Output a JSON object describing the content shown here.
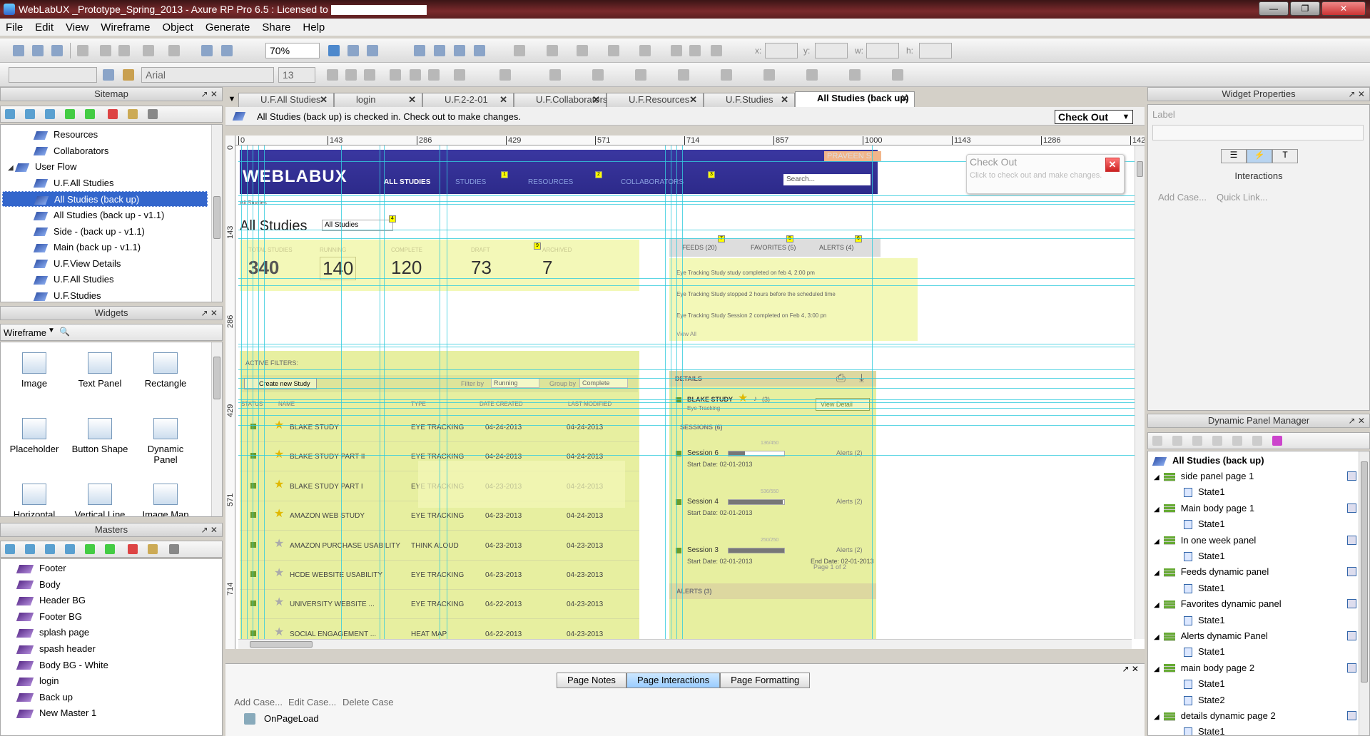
{
  "window": {
    "title": "WebLabUX _Prototype_Spring_2013 - Axure RP Pro 6.5 : Licensed to",
    "min": "—",
    "max": "❐",
    "close": "✕"
  },
  "menu": [
    "File",
    "Edit",
    "View",
    "Wireframe",
    "Object",
    "Generate",
    "Share",
    "Help"
  ],
  "toolbar": {
    "zoom": "70%",
    "x_label": "x:",
    "y_label": "y:",
    "w_label": "w:",
    "h_label": "h:",
    "font": "Arial",
    "font_size": "13",
    "style_value": ""
  },
  "sitemap": {
    "title": "Sitemap",
    "items": [
      {
        "label": "Resources",
        "indent": 2
      },
      {
        "label": "Collaborators",
        "indent": 2
      },
      {
        "label": "User Flow",
        "indent": 1,
        "folder": true
      },
      {
        "label": "U.F.All Studies",
        "indent": 2
      },
      {
        "label": "All Studies (back up)",
        "indent": 2,
        "selected": true
      },
      {
        "label": "All Studies (back up - v1.1)",
        "indent": 2
      },
      {
        "label": "Side - (back up - v1.1)",
        "indent": 2
      },
      {
        "label": "Main (back up - v1.1)",
        "indent": 2
      },
      {
        "label": "U.F.View Details",
        "indent": 2
      },
      {
        "label": "U.F.All Studies",
        "indent": 2
      },
      {
        "label": "U.F.Studies",
        "indent": 2
      }
    ]
  },
  "widgets": {
    "title": "Widgets",
    "library": "Wireframe",
    "items": [
      "Image",
      "Text Panel",
      "Rectangle",
      "Placeholder",
      "Button Shape",
      "Dynamic Panel",
      "Horizontal Line",
      "Vertical Line",
      "Image Map"
    ]
  },
  "masters": {
    "title": "Masters",
    "items": [
      "Footer",
      "Body",
      "Header BG",
      "Footer BG",
      "splash page",
      "spash header",
      "Body BG - White",
      "login",
      "Back up",
      "New Master 1"
    ]
  },
  "tabs": [
    {
      "label": "U.F.All Studies"
    },
    {
      "label": "login"
    },
    {
      "label": "U.F.2-2-01"
    },
    {
      "label": "U.F.Collaborators"
    },
    {
      "label": "U.F.Resources"
    },
    {
      "label": "U.F.Studies"
    },
    {
      "label": "All Studies (back up)",
      "active": true
    }
  ],
  "checkin": {
    "message": "All Studies (back up) is checked in. Check out to make changes.",
    "button": "Check Out"
  },
  "ruler": {
    "h": [
      "0",
      "143",
      "286",
      "429",
      "571",
      "714",
      "857",
      "1000",
      "1143",
      "1286",
      "142"
    ],
    "v": [
      "0",
      "143",
      "286",
      "429",
      "571",
      "714"
    ]
  },
  "design": {
    "logo": "WEBLABUX",
    "user": "PRAVEEN S.",
    "nav": [
      {
        "label": "ALL STUDIES",
        "badge": ""
      },
      {
        "label": "STUDIES",
        "badge": "1"
      },
      {
        "label": "RESOURCES",
        "badge": "2"
      },
      {
        "label": "COLLABORATORS",
        "badge": "3"
      }
    ],
    "search_placeholder": "Search...",
    "crumb": "All Studies",
    "page_title": "All Studies",
    "filter_select": "All Studies",
    "filter_select_badge": "4",
    "stats": [
      {
        "label": "TOTAL STUDIES",
        "value": "340"
      },
      {
        "label": "RUNNING",
        "value": "140"
      },
      {
        "label": "COMPLETE",
        "value": "120"
      },
      {
        "label": "DRAFT",
        "value": "73"
      },
      {
        "label": "ARCHIVED",
        "value": "7"
      }
    ],
    "stats_badge": "9",
    "feed_tabs": [
      {
        "label": "FEEDS (20)",
        "badge": "7"
      },
      {
        "label": "FAVORITES (5)",
        "badge": "5"
      },
      {
        "label": "ALERTS (4)",
        "badge": "6"
      }
    ],
    "feeds": [
      "Eye Tracking Study study completed on feb 4, 2:00 pm",
      "Eye Tracking Study stopped 2 hours before the scheduled time",
      "Eye Tracking Study Session 2 completed on Feb 4, 3:00 pn"
    ],
    "view_all": "View All",
    "active_filters": "ACTIVE FILTERS:",
    "create_btn": "Create new Study",
    "filter_by": "Filter by",
    "filter_by_value": "Running",
    "group_by": "Group by",
    "group_by_value": "Complete",
    "columns": [
      "STATUS",
      "NAME",
      "TYPE",
      "DATE CREATED",
      "LAST MODIFIED"
    ],
    "rows": [
      {
        "name": "BLAKE STUDY",
        "type": "EYE TRACKING",
        "created": "04-24-2013",
        "modified": "04-24-2013",
        "fav": true
      },
      {
        "name": "BLAKE STUDY PART II",
        "type": "EYE TRACKING",
        "created": "04-24-2013",
        "modified": "04-24-2013",
        "fav": true
      },
      {
        "name": "BLAKE STUDY PART I",
        "type": "EYE TRACKING",
        "created": "04-23-2013",
        "modified": "04-24-2013",
        "fav": true
      },
      {
        "name": "AMAZON WEB STUDY",
        "type": "EYE TRACKING",
        "created": "04-23-2013",
        "modified": "04-24-2013",
        "fav": true
      },
      {
        "name": "AMAZON PURCHASE USABILITY",
        "type": "THINK ALOUD",
        "created": "04-23-2013",
        "modified": "04-23-2013",
        "fav": false
      },
      {
        "name": "HCDE WEBSITE USABILITY",
        "type": "EYE TRACKING",
        "created": "04-23-2013",
        "modified": "04-23-2013",
        "fav": false
      },
      {
        "name": "UNIVERSITY WEBSITE ...",
        "type": "EYE TRACKING",
        "created": "04-22-2013",
        "modified": "04-23-2013",
        "fav": false
      },
      {
        "name": "SOCIAL ENGAGEMENT ...",
        "type": "HEAT MAP",
        "created": "04-22-2013",
        "modified": "04-23-2013",
        "fav": false
      }
    ],
    "details": {
      "title": "DETAILS",
      "study": "BLAKE STUDY",
      "study_alerts": "(3)",
      "study_type": "Eye Tracking",
      "view_btn": "View Detail",
      "sessions_title": "SESSIONS (6)",
      "sessions": [
        {
          "name": "Session 6",
          "progress": "136/450",
          "frac": 0.3,
          "alerts": "Alerts (2)",
          "start": "Start Date:  02-01-2013",
          "end": ""
        },
        {
          "name": "Session 4",
          "progress": "536/550",
          "frac": 0.97,
          "alerts": "Alerts (2)",
          "start": "Start Date:  02-01-2013",
          "end": ""
        },
        {
          "name": "Session 3",
          "progress": "250/250",
          "frac": 1.0,
          "alerts": "Alerts (2)",
          "start": "Start Date:  02-01-2013",
          "end": "End Date:  02-01-2013"
        }
      ],
      "pager": "Page 1 of 2",
      "alerts_title": "ALERTS (3)"
    }
  },
  "widget_props": {
    "title": "Widget Properties",
    "label_caption": "Label",
    "section": "Interactions",
    "add_case": "Add Case...",
    "quick_link": "Quick Link...",
    "popup_title": "Check Out",
    "popup_text": "Click to check out and make changes."
  },
  "dpm": {
    "title": "Dynamic Panel Manager",
    "root": "All Studies (back up)",
    "panels": [
      {
        "name": "side panel page 1",
        "states": [
          "State1"
        ]
      },
      {
        "name": "Main body page 1",
        "states": [
          "State1"
        ]
      },
      {
        "name": "In one week panel",
        "states": [
          "State1"
        ]
      },
      {
        "name": "Feeds dynamic panel",
        "states": [
          "State1"
        ]
      },
      {
        "name": "Favorites dynamic panel",
        "states": [
          "State1"
        ]
      },
      {
        "name": "Alerts dynamic Panel",
        "states": [
          "State1"
        ]
      },
      {
        "name": "main body page 2",
        "states": [
          "State1",
          "State2"
        ]
      },
      {
        "name": "details dynamic page 2",
        "states": [
          "State1"
        ]
      }
    ]
  },
  "bottom": {
    "tabs": [
      {
        "label": "Page Notes"
      },
      {
        "label": "Page Interactions",
        "active": true
      },
      {
        "label": "Page Formatting"
      }
    ],
    "add_case": "Add Case...",
    "edit_case": "Edit Case...",
    "delete_case": "Delete Case",
    "event": "OnPageLoad"
  },
  "colors": {
    "accent": "#3366cc",
    "header": "#2d2a8a",
    "highlight": "#f3f8b8",
    "guide": "#33ccdd"
  }
}
